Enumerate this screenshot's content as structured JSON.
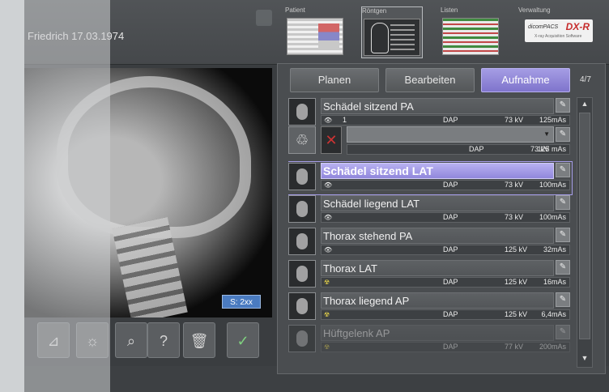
{
  "header": {
    "patient": "Friedrich 17.03.1974",
    "tabs": [
      {
        "label": "Patient"
      },
      {
        "label": "Röntgen"
      },
      {
        "label": "Listen"
      },
      {
        "label": "Verwaltung"
      }
    ],
    "logo_main": "dicomPACS",
    "logo_brand": "DX-R",
    "logo_sub": "X-ray Acquisition Software"
  },
  "viewer": {
    "badge": "S: 2xx"
  },
  "actions": {
    "plan": "Planen",
    "edit": "Bearbeiten",
    "acquire": "Aufnahme",
    "counter": "4/7"
  },
  "exams": [
    {
      "title": "Schädel sitzend PA",
      "dap": "DAP",
      "kv": "73 kV",
      "mas": "125mAs",
      "count": "1"
    },
    {
      "title": "",
      "dap": "DAP",
      "kv": "73 kV",
      "mas": "125 mAs"
    },
    {
      "title": "Schädel sitzend LAT",
      "dap": "DAP",
      "kv": "73 kV",
      "mas": "100mAs"
    },
    {
      "title": "Schädel liegend LAT",
      "dap": "DAP",
      "kv": "73 kV",
      "mas": "100mAs"
    },
    {
      "title": "Thorax stehend PA",
      "dap": "DAP",
      "kv": "125 kV",
      "mas": "32mAs"
    },
    {
      "title": "Thorax LAT",
      "dap": "DAP",
      "kv": "125 kV",
      "mas": "16mAs"
    },
    {
      "title": "Thorax liegend AP",
      "dap": "DAP",
      "kv": "125 kV",
      "mas": "6,4mAs"
    },
    {
      "title": "Hüftgelenk AP",
      "dap": "DAP",
      "kv": "77 kV",
      "mas": "200mAs"
    }
  ],
  "colors": {
    "accent": "#9187dc",
    "panel": "#4a4d50"
  }
}
